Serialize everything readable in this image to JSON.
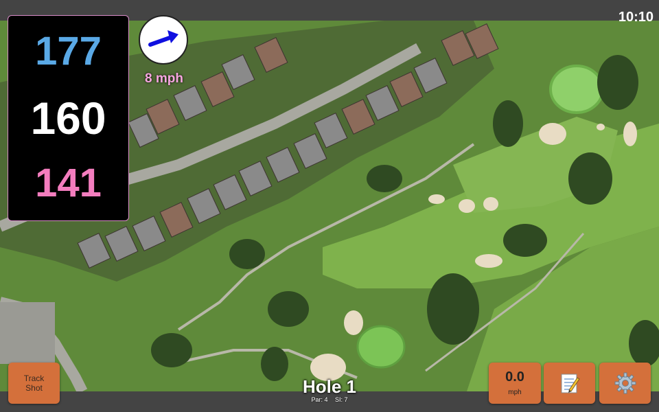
{
  "status": {
    "time": "10:10"
  },
  "yardage": {
    "back": "177",
    "middle": "160",
    "front": "141"
  },
  "wind": {
    "speed_label": "8 mph",
    "direction_icon": "arrow-right-icon"
  },
  "hole": {
    "title": "Hole 1",
    "par_label": "Par: 4",
    "si_label": "SI: 7"
  },
  "buttons": {
    "track_shot_line1": "Track",
    "track_shot_line2": "Shot",
    "speed_value": "0.0",
    "speed_unit": "mph",
    "notes_icon": "notepad-icon",
    "settings_icon": "gear-icon"
  },
  "colors": {
    "back_yardage": "#5aa9e6",
    "middle_yardage": "#ffffff",
    "front_yardage": "#f37dbe",
    "button": "#d4703b",
    "wind_arrow": "#1010e0"
  }
}
